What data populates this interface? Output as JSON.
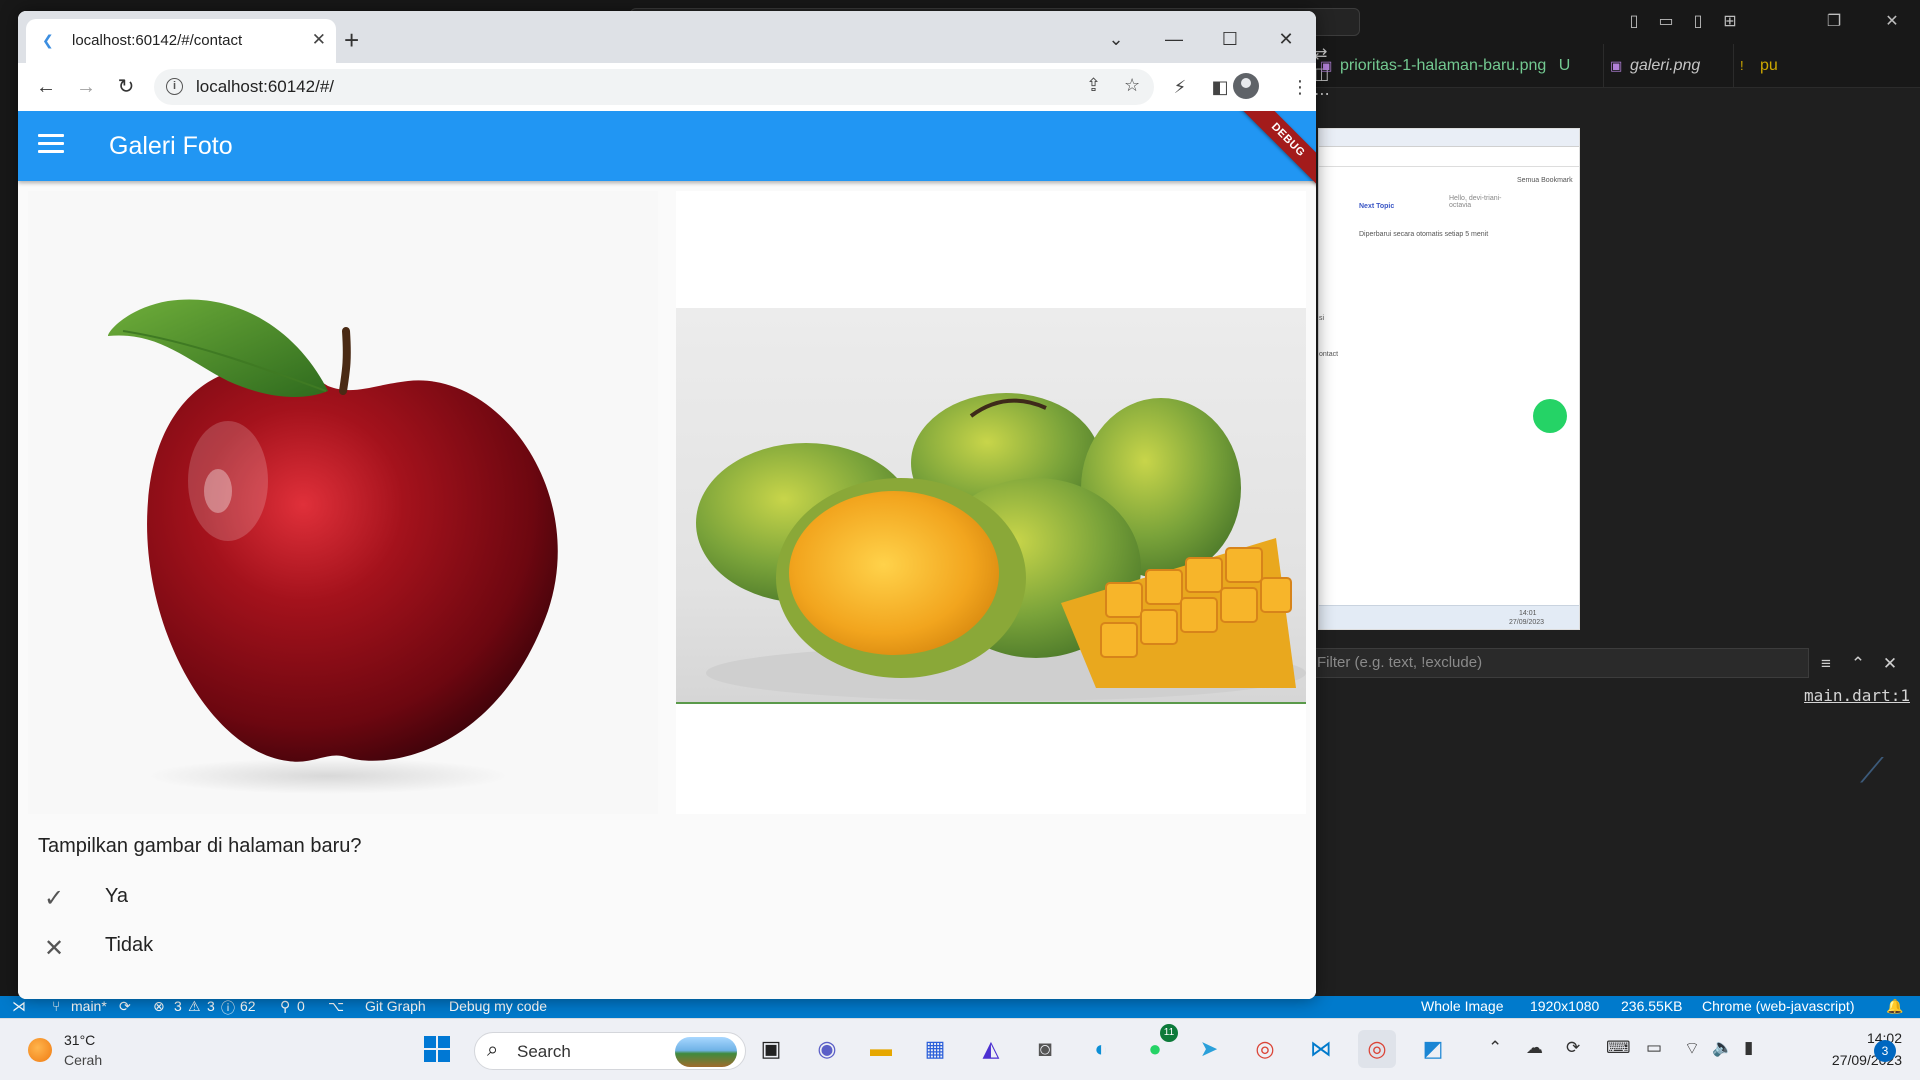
{
  "browser": {
    "tab_title": "localhost:60142/#/contact",
    "url": "localhost:60142/#/"
  },
  "app": {
    "title": "Galeri Foto",
    "debug_banner": "DEBUG",
    "images": [
      {
        "subject": "apple"
      },
      {
        "subject": "mango"
      }
    ],
    "question": "Tampilkan gambar di halaman baru?",
    "options": [
      {
        "label": "Ya",
        "icon": "check-icon"
      },
      {
        "label": "Tidak",
        "icon": "close-icon"
      }
    ]
  },
  "vscode": {
    "tabs": [
      {
        "label": "prioritas-1-halaman-baru.png",
        "badge": "U"
      },
      {
        "label": "galeri.png"
      },
      {
        "label": "pu",
        "badge": "!"
      }
    ],
    "filter_placeholder": "Filter (e.g. text, !exclude)",
    "source_link": "main.dart:1",
    "preview": {
      "next_topic": "Next Topic",
      "greeting": "Hello, devi-triani-octavia",
      "bookmark": "Semua Bookmark",
      "updated": "Diperbarui secara otomatis setiap 5 menit",
      "side_a": "si",
      "side_b": "ontact",
      "time": "14:01",
      "date": "27/09/2023"
    }
  },
  "statusbar": {
    "branch": "main*",
    "problems": "3",
    "warnings": "3",
    "infos": "62",
    "ports": "0",
    "git_graph": "Git Graph",
    "debug": "Debug my code",
    "image_label": "Whole Image",
    "dimensions": "1920x1080",
    "size": "236.55KB",
    "device": "Chrome (web-javascript)"
  },
  "taskbar": {
    "weather_temp": "31°C",
    "weather_desc": "Cerah",
    "search": "Search",
    "whatsapp_badge": "11",
    "time": "14:02",
    "date": "27/09/2023",
    "notifications": "3"
  }
}
